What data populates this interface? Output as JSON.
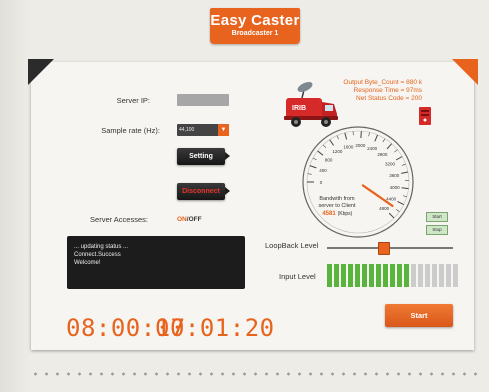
{
  "header": {
    "title": "Easy Caster",
    "subtitle": "Broadcaster 1"
  },
  "form": {
    "server_ip_label": "Server IP:",
    "server_ip_value": "",
    "sample_rate_label": "Sample rate (Hz):",
    "sample_rate_value": "44,100",
    "setting_button": "Setting",
    "disconnect_button": "Disconnect",
    "server_accesses_label": "Server Accesses:",
    "on_label": "ON",
    "separator": "/",
    "off_label": "OFF"
  },
  "console": {
    "lines": [
      "... updating status ...",
      "Connect.Success",
      "Welcome!"
    ]
  },
  "timers": {
    "elapsed": "08:00:17",
    "session": "00:01:20"
  },
  "stats": {
    "output_bytes": "Output Byte_Count = 880 k",
    "response_time": "Response Time = 97ms",
    "net_status": "Net Status Code =  200"
  },
  "van": {
    "label": "IRIB"
  },
  "gauge": {
    "caption_line1": "Bandwith from",
    "caption_line2": "server to Client",
    "value": "4581",
    "unit": "(Kbps)",
    "tick_labels": [
      "0",
      "400",
      "800",
      "1200",
      "1600",
      "2000",
      "2400",
      "2800",
      "3200",
      "3600",
      "4000",
      "4400",
      "4800"
    ],
    "start_label": "Start",
    "stop_label": "Stop"
  },
  "levels": {
    "loopback_label": "LoopBack Level",
    "loopback_fraction": 0.45,
    "input_label": "Input Level",
    "input_total_segments": 19,
    "input_active_segments": 12
  },
  "actions": {
    "start_button": "Start"
  },
  "colors": {
    "accent": "#e8631d",
    "green": "#58b43c",
    "inactive": "#cccccc"
  }
}
